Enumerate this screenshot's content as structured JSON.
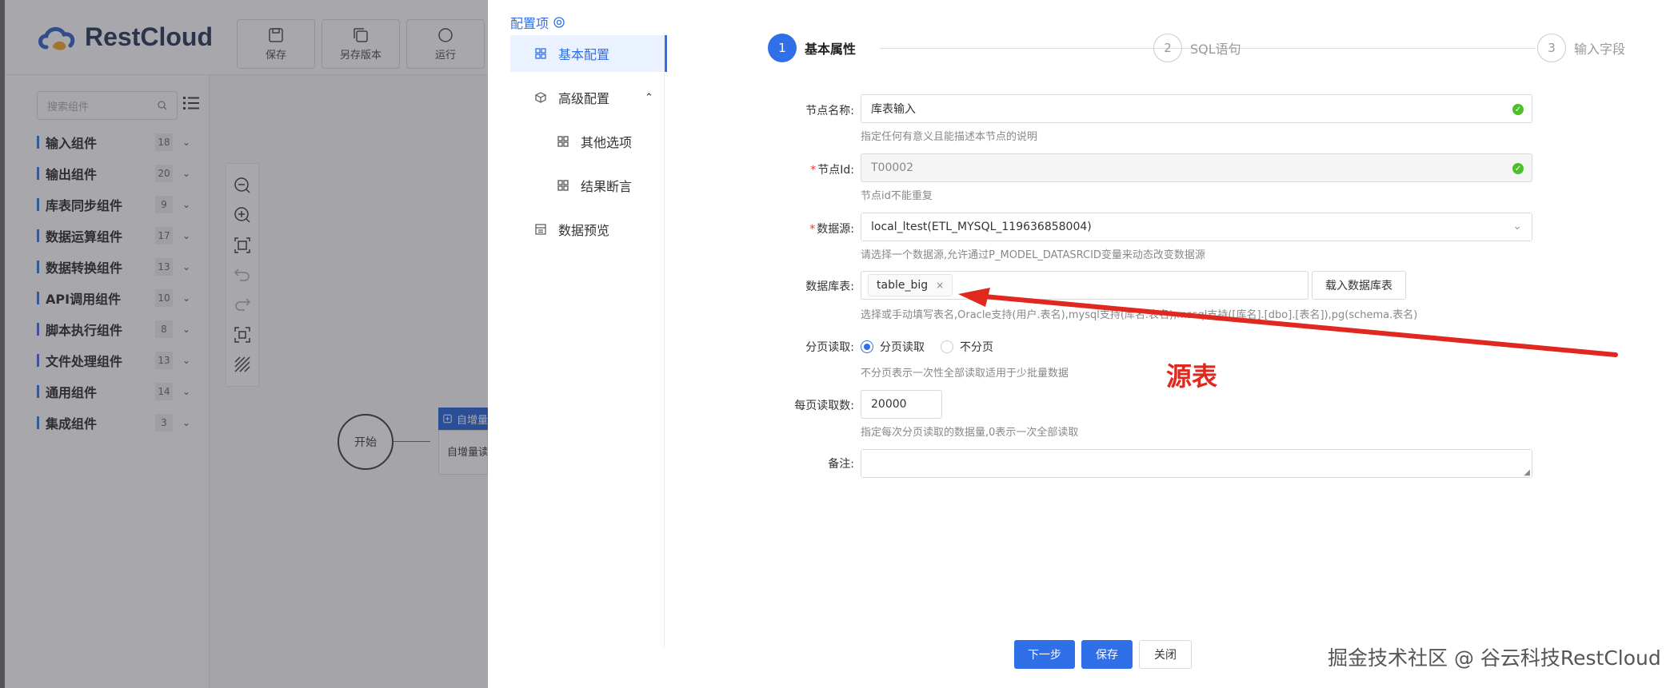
{
  "app": {
    "logo_text": "RestCloud",
    "toolbar": [
      {
        "label": "保存",
        "icon": "save-icon"
      },
      {
        "label": "另存版本",
        "icon": "copy-icon"
      },
      {
        "label": "运行",
        "icon": "run-icon"
      }
    ],
    "search_placeholder": "搜索组件",
    "categories": [
      {
        "label": "输入组件",
        "count": "18"
      },
      {
        "label": "输出组件",
        "count": "20"
      },
      {
        "label": "库表同步组件",
        "count": "9"
      },
      {
        "label": "数据运算组件",
        "count": "17"
      },
      {
        "label": "数据转换组件",
        "count": "13"
      },
      {
        "label": "API调用组件",
        "count": "10"
      },
      {
        "label": "脚本执行组件",
        "count": "8"
      },
      {
        "label": "文件处理组件",
        "count": "13"
      },
      {
        "label": "通用组件",
        "count": "14"
      },
      {
        "label": "集成组件",
        "count": "3"
      }
    ],
    "canvas": {
      "start_label": "开始",
      "node_title": "自增量",
      "node_body": "自增量读"
    }
  },
  "drawer": {
    "config_title": "配置项",
    "menu": [
      {
        "label": "基本配置",
        "icon": "grid-icon",
        "active": true
      },
      {
        "label": "高级配置",
        "icon": "cube-icon",
        "active": false
      },
      {
        "label": "其他选项",
        "icon": "grid-icon",
        "active": false
      },
      {
        "label": "结果断言",
        "icon": "grid-icon",
        "active": false
      },
      {
        "label": "数据预览",
        "icon": "table-icon",
        "active": false
      }
    ],
    "steps": [
      {
        "num": "1",
        "label": "基本属性"
      },
      {
        "num": "2",
        "label": "SQL语句"
      },
      {
        "num": "3",
        "label": "输入字段"
      }
    ],
    "form": {
      "node_name": {
        "label": "节点名称:",
        "value": "库表输入",
        "hint": "指定任何有意义且能描述本节点的说明"
      },
      "node_id": {
        "label": "节点Id:",
        "value": "T00002",
        "hint": "节点id不能重复"
      },
      "datasource": {
        "label": "数据源:",
        "value": "local_ltest(ETL_MYSQL_119636858004)",
        "hint": "请选择一个数据源,允许通过P_MODEL_DATASRCID变量来动态改变数据源"
      },
      "table": {
        "label": "数据库表:",
        "tag": "table_big",
        "load_button": "载入数据库表",
        "hint": "选择或手动填写表名,Oracle支持(用户.表名),mysql支持(库名.表名),mssql支持([库名].[dbo].[表名]),pg(schema.表名)"
      },
      "paging": {
        "label": "分页读取:",
        "option_yes": "分页读取",
        "option_no": "不分页",
        "hint": "不分页表示一次性全部读取适用于少批量数据"
      },
      "page_size": {
        "label": "每页读取数:",
        "value": "20000",
        "hint": "指定每次分页读取的数据量,0表示一次全部读取"
      },
      "remark": {
        "label": "备注:",
        "value": ""
      }
    },
    "buttons": {
      "next": "下一步",
      "save": "保存",
      "close": "关闭"
    }
  },
  "annotation": {
    "text": "源表",
    "color": "#e0281e"
  },
  "watermark": "掘金技术社区 @ 谷云科技RestCloud",
  "colors": {
    "primary": "#2f6fe8",
    "success": "#4ac02b",
    "required": "#e03c3c"
  }
}
